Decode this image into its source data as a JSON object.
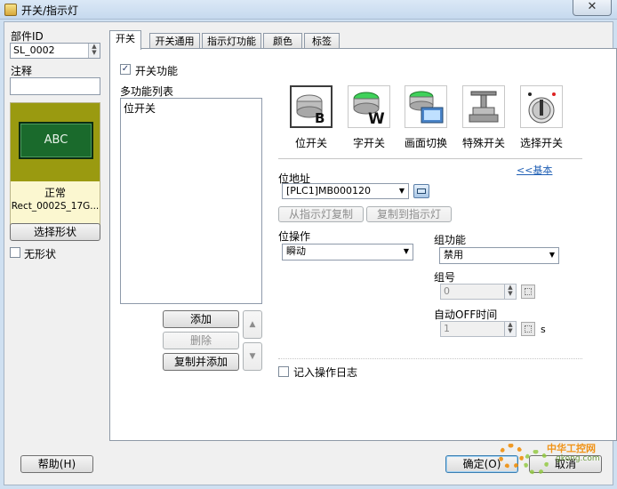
{
  "window": {
    "title": "开关/指示灯",
    "close_glyph": "✕"
  },
  "left": {
    "part_id_label": "部件ID",
    "part_id_value": "SL_0002",
    "comment_label": "注释",
    "comment_value": "",
    "preview_text": "ABC",
    "state_label": "正常",
    "shape_name": "Rect_0002S_17G...",
    "select_shape_label": "选择形状",
    "no_shape_label": "无形状",
    "no_shape_checked": false
  },
  "tabs": [
    {
      "label": "开关"
    },
    {
      "label": "开关通用"
    },
    {
      "label": "指示灯功能"
    },
    {
      "label": "颜色"
    },
    {
      "label": "标签"
    }
  ],
  "switch_tab": {
    "switch_function_label": "开关功能",
    "switch_function_checked": true,
    "multi_function_list_label": "多功能列表",
    "list_items": [
      "位开关"
    ],
    "add_label": "添加",
    "delete_label": "删除",
    "copy_add_label": "复制并添加",
    "functions": [
      {
        "label": "位开关",
        "icon": "bit-switch-icon",
        "selected": true
      },
      {
        "label": "字开关",
        "icon": "word-switch-icon",
        "selected": false
      },
      {
        "label": "画面切换",
        "icon": "screen-change-icon",
        "selected": false
      },
      {
        "label": "特殊开关",
        "icon": "special-switch-icon",
        "selected": false
      },
      {
        "label": "选择开关",
        "icon": "selector-switch-icon",
        "selected": false
      }
    ],
    "basic_link": "<<基本",
    "bit_address_label": "位地址",
    "bit_address_value": "[PLC1]MB000120",
    "copy_from_lamp_label": "从指示灯复制",
    "copy_to_lamp_label": "复制到指示灯",
    "bit_action_label": "位操作",
    "bit_action_value": "瞬动",
    "group_function_label": "组功能",
    "group_function_value": "禁用",
    "group_number_label": "组号",
    "group_number_value": "0",
    "auto_off_label": "自动OFF时间",
    "auto_off_value": "1",
    "auto_off_unit": "s",
    "log_label": "记入操作日志",
    "log_checked": false
  },
  "footer": {
    "help_label": "帮助(H)",
    "ok_label": "确定(O)",
    "cancel_label": "取消"
  },
  "watermark": {
    "text": "中华工控网",
    "sub": "gkong.com"
  },
  "colors": {
    "preview_bg": "#1a6a2c",
    "preview_area_bg": "#9a9a10",
    "state_bg": "#fbf7d0",
    "accent_blue": "#1f5fb4",
    "watermark_orange": "#f08a00"
  }
}
